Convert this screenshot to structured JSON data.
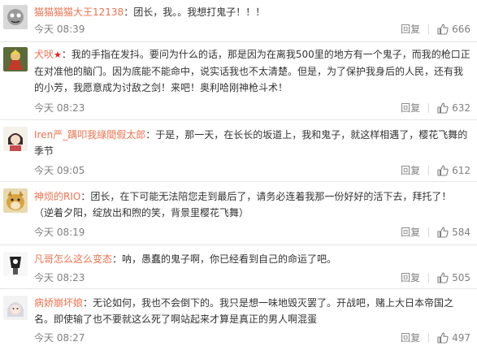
{
  "comments": [
    {
      "username": "猫猫猫猫大王12138",
      "text": "：团长，我。。我想打鬼子！！！",
      "time": "今天 08:39",
      "reply": "回复",
      "likes": "666"
    },
    {
      "username": "犬吠",
      "text": "：我的手指在发抖。要问为什么的话，那是因为在离我500里的地方有一个鬼子，而我的枪口正在对准他的脑门。因为底能不能命中，说实话我也不太清楚。但是，为了保护我身后的人民，还有我的小芳，我愿意成为讨敌之剑！来吧！奥利哈刚神枪斗术！",
      "time": "今天 08:23",
      "reply": "回复",
      "likes": "632"
    },
    {
      "username": "Iren严_蹒叩我綠間假太郎",
      "text": "：于是，那一天，在长长的坂道上，我和鬼子，就这样相遇了，樱花飞舞的季节",
      "time": "今天 09:05",
      "reply": "回复",
      "likes": "612"
    },
    {
      "username": "神烦的RIO",
      "text": "：团长，在下可能无法陪您走到最后了，请务必连着我那一份好好的活下去，拜托了！（逆着夕阳，绽放出和煦的笑，背景里樱花飞舞）",
      "time": "今天 08:19",
      "reply": "回复",
      "likes": "584"
    },
    {
      "username": "凡哥怎么这么变态",
      "text": "：呐，愚蠢的鬼子啊，你已经看到自己的命运了吧。",
      "time": "今天 08:23",
      "reply": "回复",
      "likes": "505"
    },
    {
      "username": "病娇崩坏娘",
      "text": "：无论如何，我也不会倒下的。我只是想一味地毁灭罢了。开战吧，赌上大日本帝国之名。即使输了也不要就这么死了啊站起来才算是真正的男人啊混蛋",
      "time": "今天 08:27",
      "reply": "回复",
      "likes": "497"
    }
  ],
  "colors": {
    "username": "#eb7350",
    "text": "#333333",
    "meta": "#808080",
    "badge": "#e8201a"
  },
  "icons": {
    "like": "thumbs-up-icon",
    "badge": "star-icon"
  }
}
